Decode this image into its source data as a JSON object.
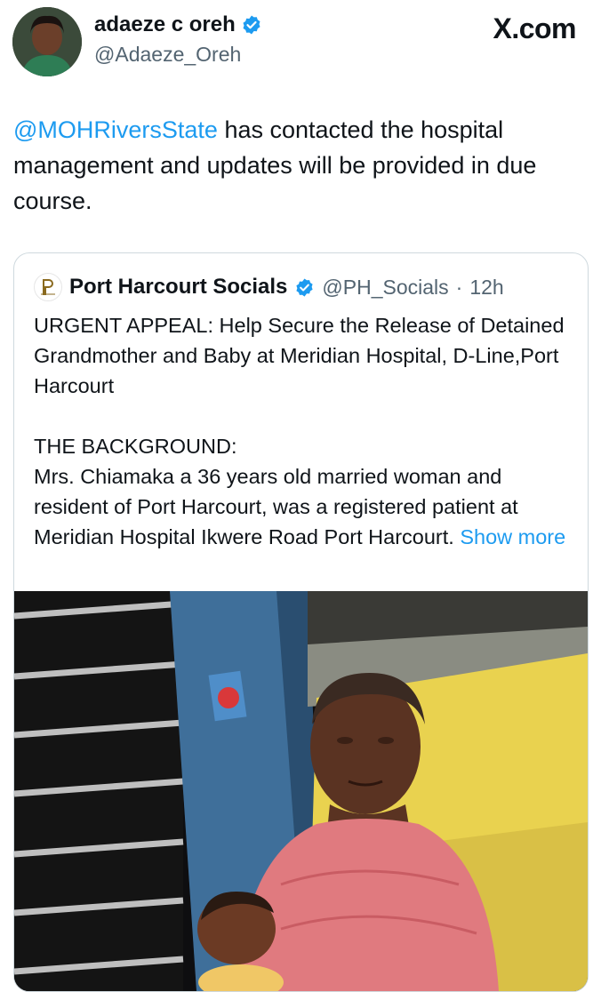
{
  "author": {
    "display_name": "adaeze c oreh",
    "handle": "@Adaeze_Oreh",
    "avatar_icon": "profile-photo"
  },
  "site_label": "X.com",
  "tweet": {
    "mention": "@MOHRiversState",
    "text": " has contacted the hospital management and updates will be provided in due course."
  },
  "quote": {
    "display_name": "Port Harcourt Socials",
    "handle": "@PH_Socials",
    "separator": "·",
    "time": "12h",
    "headline": "URGENT APPEAL: Help Secure the Release of Detained Grandmother and Baby at Meridian Hospital, D-Line,Port Harcourt",
    "section_title": "THE BACKGROUND:",
    "body": "Mrs. Chiamaka a 36 years old married woman and resident of Port Harcourt, was a registered patient at Meridian Hospital Ikwere Road Port Harcourt.",
    "show_more": "Show more"
  },
  "colors": {
    "link": "#1d9bf0",
    "verified": "#1d9bf0",
    "muted": "#536471",
    "border": "#cfd9de"
  }
}
